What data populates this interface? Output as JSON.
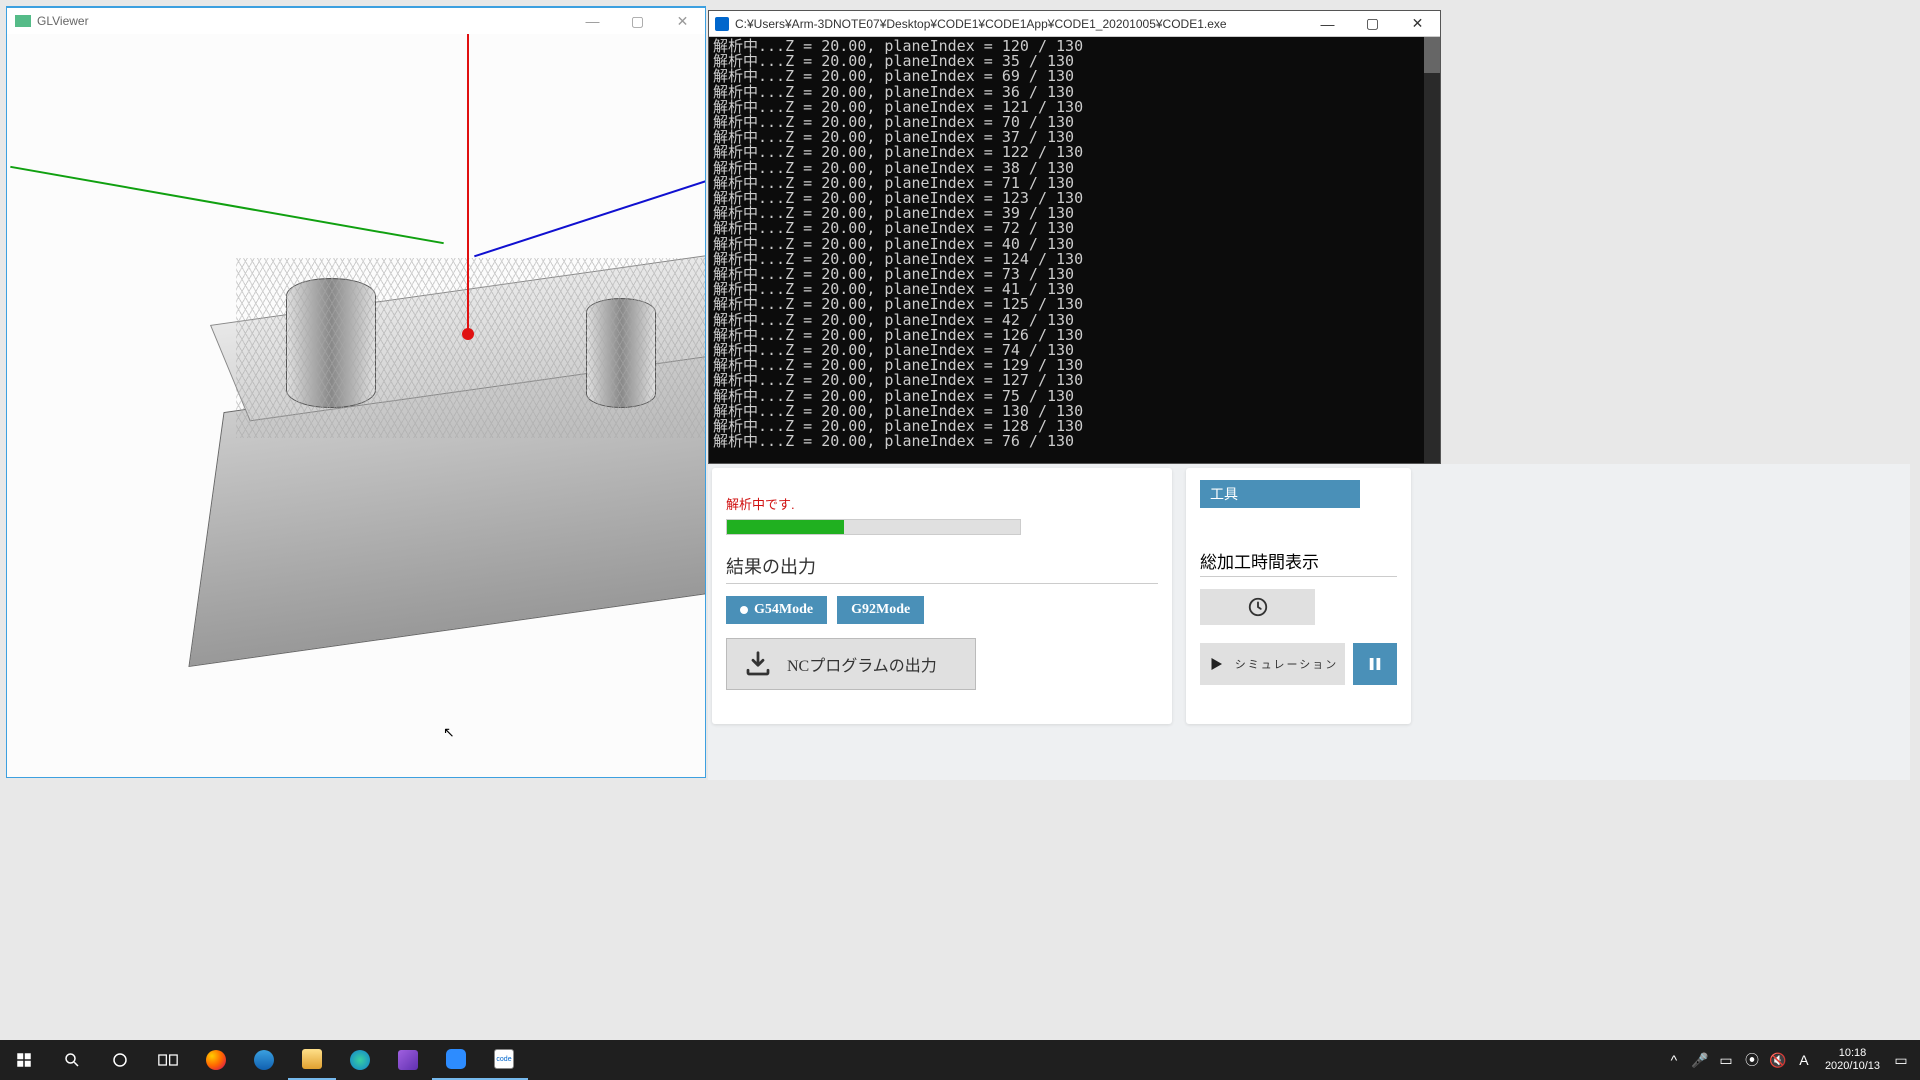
{
  "gl_window": {
    "title": "GLViewer"
  },
  "console": {
    "title": "C:¥Users¥Arm-3DNOTE07¥Desktop¥CODE1¥CODE1App¥CODE1_20201005¥CODE1.exe",
    "lines": [
      "解析中...Z = 20.00, planeIndex = 120 / 130",
      "解析中...Z = 20.00, planeIndex = 35 / 130",
      "解析中...Z = 20.00, planeIndex = 69 / 130",
      "解析中...Z = 20.00, planeIndex = 36 / 130",
      "解析中...Z = 20.00, planeIndex = 121 / 130",
      "解析中...Z = 20.00, planeIndex = 70 / 130",
      "解析中...Z = 20.00, planeIndex = 37 / 130",
      "解析中...Z = 20.00, planeIndex = 122 / 130",
      "解析中...Z = 20.00, planeIndex = 38 / 130",
      "解析中...Z = 20.00, planeIndex = 71 / 130",
      "解析中...Z = 20.00, planeIndex = 123 / 130",
      "解析中...Z = 20.00, planeIndex = 39 / 130",
      "解析中...Z = 20.00, planeIndex = 72 / 130",
      "解析中...Z = 20.00, planeIndex = 40 / 130",
      "解析中...Z = 20.00, planeIndex = 124 / 130",
      "解析中...Z = 20.00, planeIndex = 73 / 130",
      "解析中...Z = 20.00, planeIndex = 41 / 130",
      "解析中...Z = 20.00, planeIndex = 125 / 130",
      "解析中...Z = 20.00, planeIndex = 42 / 130",
      "解析中...Z = 20.00, planeIndex = 126 / 130",
      "解析中...Z = 20.00, planeIndex = 74 / 130",
      "解析中...Z = 20.00, planeIndex = 129 / 130",
      "解析中...Z = 20.00, planeIndex = 127 / 130",
      "解析中...Z = 20.00, planeIndex = 75 / 130",
      "解析中...Z = 20.00, planeIndex = 130 / 130",
      "解析中...Z = 20.00, planeIndex = 128 / 130",
      "解析中...Z = 20.00, planeIndex = 76 / 130"
    ]
  },
  "app": {
    "status": "解析中です.",
    "progress_pct": 40,
    "output_title": "結果の出力",
    "mode_g54": "G54Mode",
    "mode_g92": "G92Mode",
    "nc_output": "NCプログラムの出力",
    "tool_header": "工具",
    "time_title": "総加工時間表示",
    "simulation": "シミュレーション"
  },
  "taskbar": {
    "time": "10:18",
    "date": "2020/10/13",
    "ime": "A"
  }
}
